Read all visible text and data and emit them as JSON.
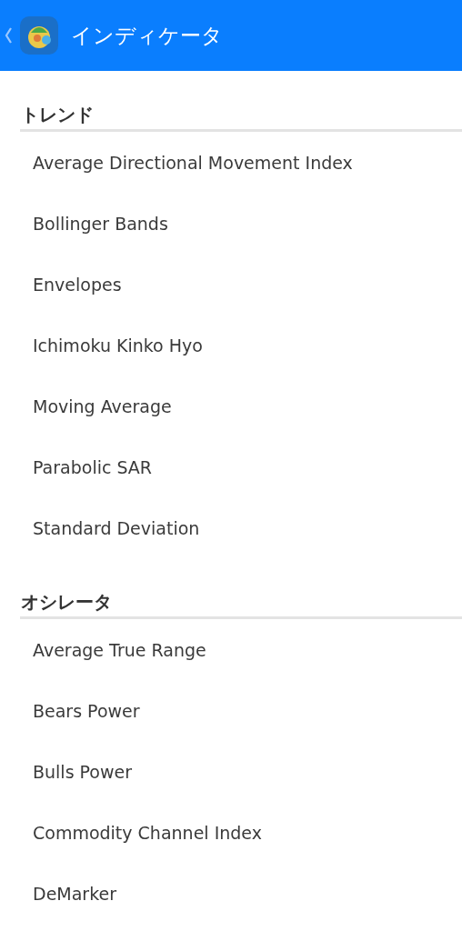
{
  "app_bar": {
    "title": "インディケータ"
  },
  "sections": [
    {
      "title": "トレンド",
      "items": [
        "Average Directional Movement Index",
        "Bollinger Bands",
        "Envelopes",
        "Ichimoku Kinko Hyo",
        "Moving Average",
        "Parabolic SAR",
        "Standard Deviation"
      ]
    },
    {
      "title": "オシレータ",
      "items": [
        "Average True Range",
        "Bears Power",
        "Bulls Power",
        "Commodity Channel Index",
        "DeMarker"
      ]
    }
  ]
}
